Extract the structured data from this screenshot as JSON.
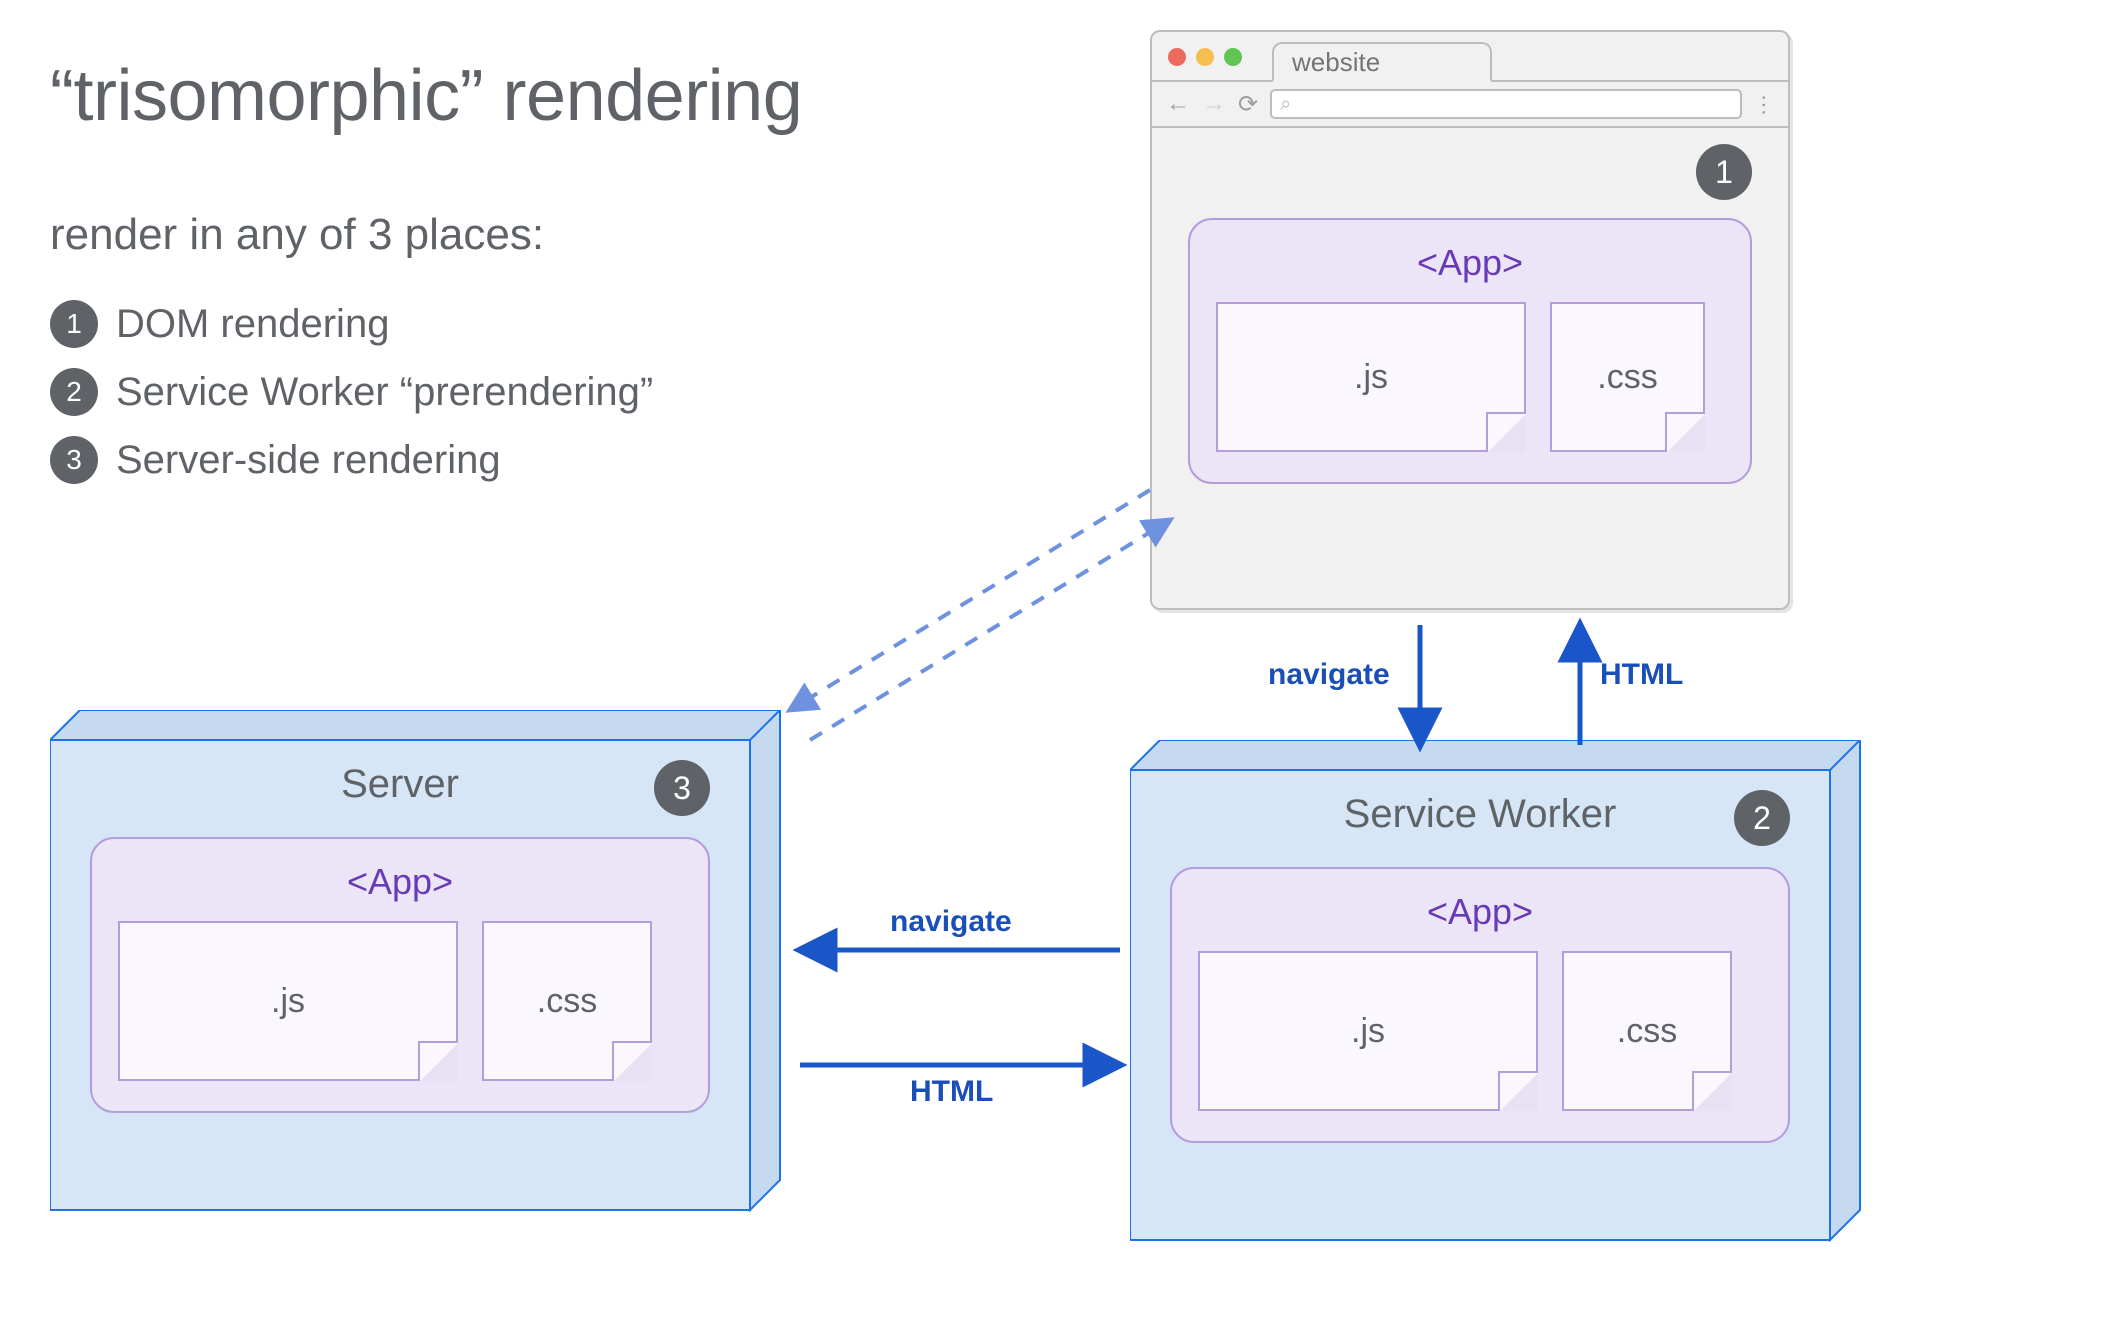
{
  "title": "“trisomorphic” rendering",
  "subtitle": "render in any of 3 places:",
  "list": [
    {
      "num": "1",
      "label": "DOM rendering"
    },
    {
      "num": "2",
      "label": "Service Worker “prerendering”"
    },
    {
      "num": "3",
      "label": "Server-side rendering"
    }
  ],
  "browser": {
    "tab_label": "website",
    "badge": "1",
    "app_label": "<App>",
    "file_js": ".js",
    "file_css": ".css"
  },
  "server_panel": {
    "title": "Server",
    "badge": "3",
    "app_label": "<App>",
    "file_js": ".js",
    "file_css": ".css"
  },
  "sw_panel": {
    "title": "Service Worker",
    "badge": "2",
    "app_label": "<App>",
    "file_js": ".js",
    "file_css": ".css"
  },
  "arrows": {
    "browser_to_sw": "navigate",
    "sw_to_browser": "HTML",
    "sw_to_server": "navigate",
    "server_to_sw": "HTML"
  },
  "colors": {
    "text": "#5f6368",
    "badge_bg": "#5f6368",
    "panel_border": "#1a73e8",
    "panel_fill_front": "#d6e6f7",
    "panel_fill_back": "#c5d9f1",
    "app_fill": "#ece4f7",
    "app_border": "#b39ddb",
    "app_text": "#673ab7",
    "arrow": "#1a56c7",
    "arrow_dashed": "#6e91e0"
  }
}
